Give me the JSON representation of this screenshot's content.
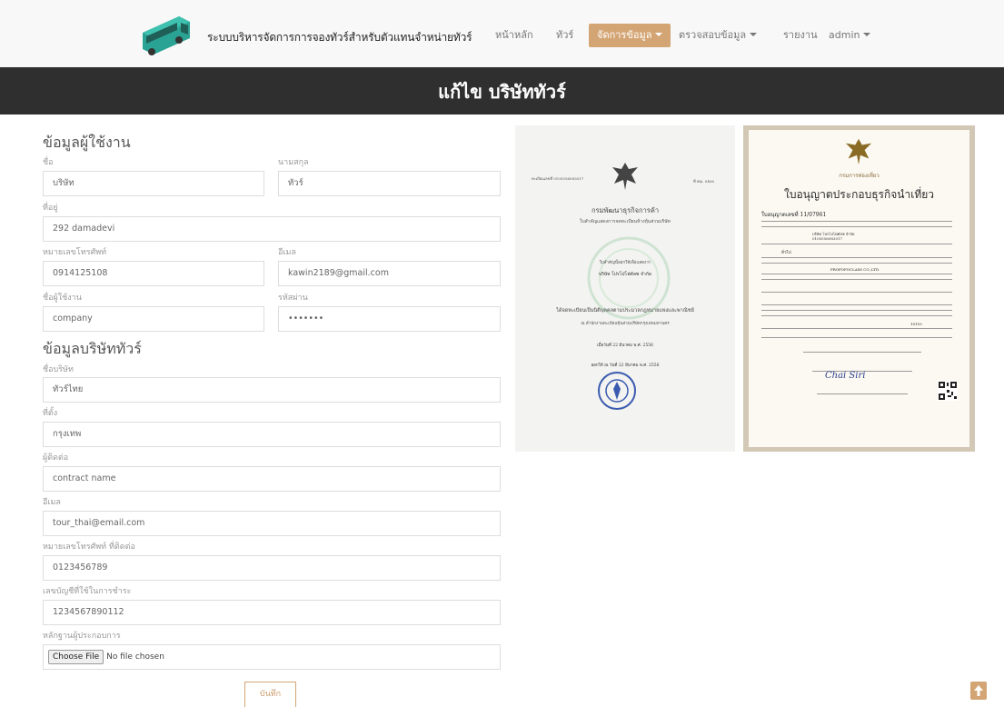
{
  "navbar": {
    "brand": "ระบบบริหารจัดการการจองทัวร์สำหรับตัวแทนจำหน่ายทัวร์",
    "items": [
      "หน้าหลัก",
      "ทัวร์",
      "จัดการข้อมูล",
      "ตรวจสอบข้อมูล",
      "รายงาน",
      "admin"
    ],
    "accent": "#d4a574"
  },
  "page_title": "แก้ไข บริษัททัวร์",
  "user_section": {
    "title": "ข้อมูลผู้ใช้งาน",
    "fields": {
      "first_name": {
        "label": "ชื่อ",
        "value": "บริษัท"
      },
      "last_name": {
        "label": "นามสกุล",
        "value": "ทัวร์"
      },
      "address": {
        "label": "ที่อยู่",
        "value": "292 damadevi"
      },
      "phone": {
        "label": "หมายเลขโทรศัพท์",
        "value": "0914125108"
      },
      "email": {
        "label": "อีเมล",
        "value": "kawin2189@gmail.com"
      },
      "username": {
        "label": "ชื่อผู้ใช้งาน",
        "value": "company"
      },
      "password": {
        "label": "รหัสผ่าน",
        "value": "•••••••"
      }
    }
  },
  "company_section": {
    "title": "ข้อมูลบริษัททัวร์",
    "fields": {
      "company_name": {
        "label": "ชื่อบริษัท",
        "value": "ทัวร์ไทย"
      },
      "location": {
        "label": "ที่ตั้ง",
        "value": "กรุงเทพ"
      },
      "contact": {
        "label": "ผู้ติดต่อ",
        "value": "contract name"
      },
      "email": {
        "label": "อีเมล",
        "value": "tour_thai@email.com"
      },
      "contact_phone": {
        "label": "หมายเลขโทรศัพท์ ที่ติดต่อ",
        "value": "0123456789"
      },
      "bank_account": {
        "label": "เลขบัญชีที่ใช้ในการชำระ",
        "value": "1234567890112"
      },
      "evidence": {
        "label": "หลักฐานผู้ประกอบการ",
        "button": "Choose File",
        "status": "No file chosen"
      }
    },
    "save_label": "บันทึก"
  },
  "documents": {
    "doc1": {
      "top_left": "ทะเบียนเลขที่ 0105556083017",
      "top_right": "ที่ พณ. 0406",
      "dept": "กรมพัฒนาธุรกิจการค้า",
      "subtitle": "ใบสำคัญแสดงการจดทะเบียนห้างหุ้นส่วนบริษัท",
      "certify": "ใบสำคัญนี้ออกให้เพื่อแสดงว่า",
      "company": "บริษัท โปรโปโฟคัลซ จำกัด",
      "registered": "ได้จดทะเบียนเป็นนิติบุคคลตามประมวลกฎหมายแพ่งและพาณิชย์",
      "office": "ณ สำนักงานทะเบียนหุ้นส่วนบริษัทกรุงเทพมหานคร",
      "date1": "เมื่อวันที่ 22 มีนาคม พ.ศ. 2556",
      "date2": "ออกให้ ณ วันที่ 22 มีนาคม พ.ศ. 2556"
    },
    "doc2": {
      "dept": "กรมการท่องเที่ยว",
      "title": "ใบอนุญาตประกอบธุรกิจนำเที่ยว",
      "license_no": "ใบอนุญาตเลขที่ 11/07961",
      "company_name": "บริษัท โปรโปโฟคัลซ จำกัด",
      "reg_no": "0105556083017",
      "area": "ทั่วไป",
      "english_name": "PROPOFOCLASS CO.,LTD.",
      "zip": "10110",
      "signature": "Chai Siri"
    }
  }
}
